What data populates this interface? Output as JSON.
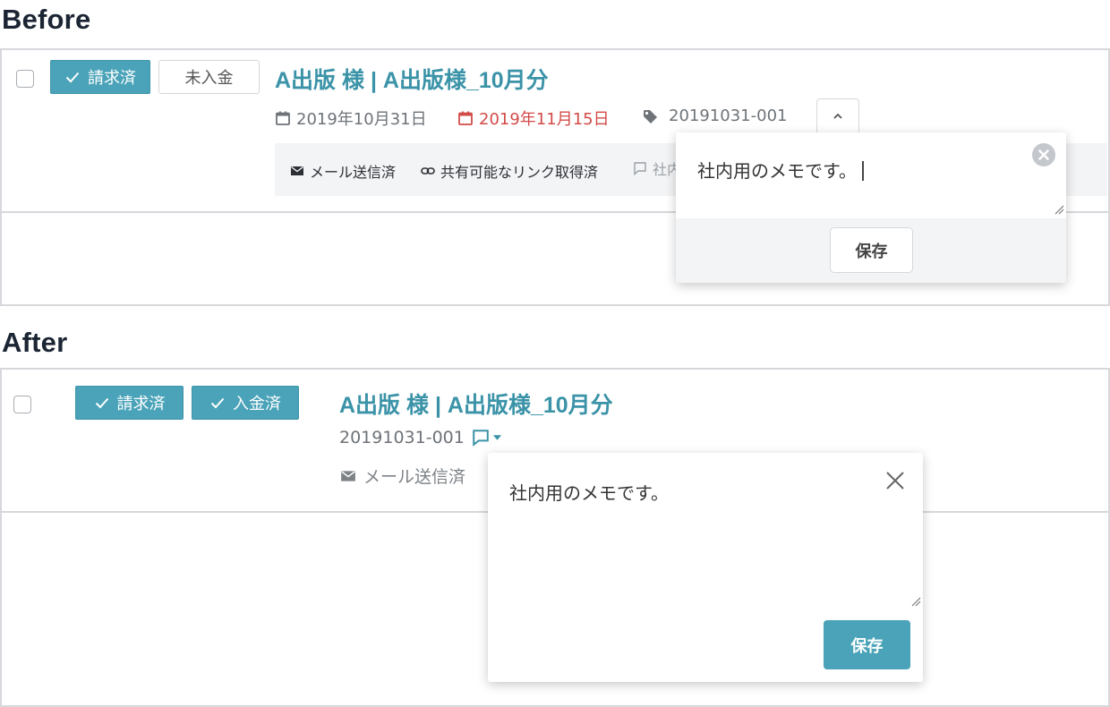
{
  "before": {
    "heading": "Before",
    "badges": {
      "billed": "請求済",
      "payment": "未入金"
    },
    "title": "A出版 様 | A出版様_10月分",
    "meta": {
      "issue_date": "2019年10月31日",
      "due_date": "2019年11月15日",
      "doc_number": "20191031-001"
    },
    "status": {
      "mail": "メール送信済",
      "link": "共有可能なリンク取得済",
      "memo_truncated": "社内"
    },
    "memo": {
      "text": "社内用のメモです。",
      "save_label": "保存"
    },
    "colors": {
      "accent": "#4aa3b8",
      "title": "#3b93a8",
      "due_date": "#d24b48"
    }
  },
  "after": {
    "heading": "After",
    "badges": {
      "billed": "請求済",
      "payment": "入金済"
    },
    "title": "A出版 様 | A出版様_10月分",
    "doc_number": "20191031-001",
    "status": {
      "mail": "メール送信済"
    },
    "memo": {
      "text": "社内用のメモです。",
      "save_label": "保存"
    }
  },
  "icons": [
    "check-icon",
    "calendar-icon",
    "tag-icon",
    "chevron-up-icon",
    "mail-icon",
    "link-icon",
    "comment-icon",
    "close-circle-icon",
    "close-icon",
    "caret-down-icon",
    "resize-handle-icon"
  ]
}
